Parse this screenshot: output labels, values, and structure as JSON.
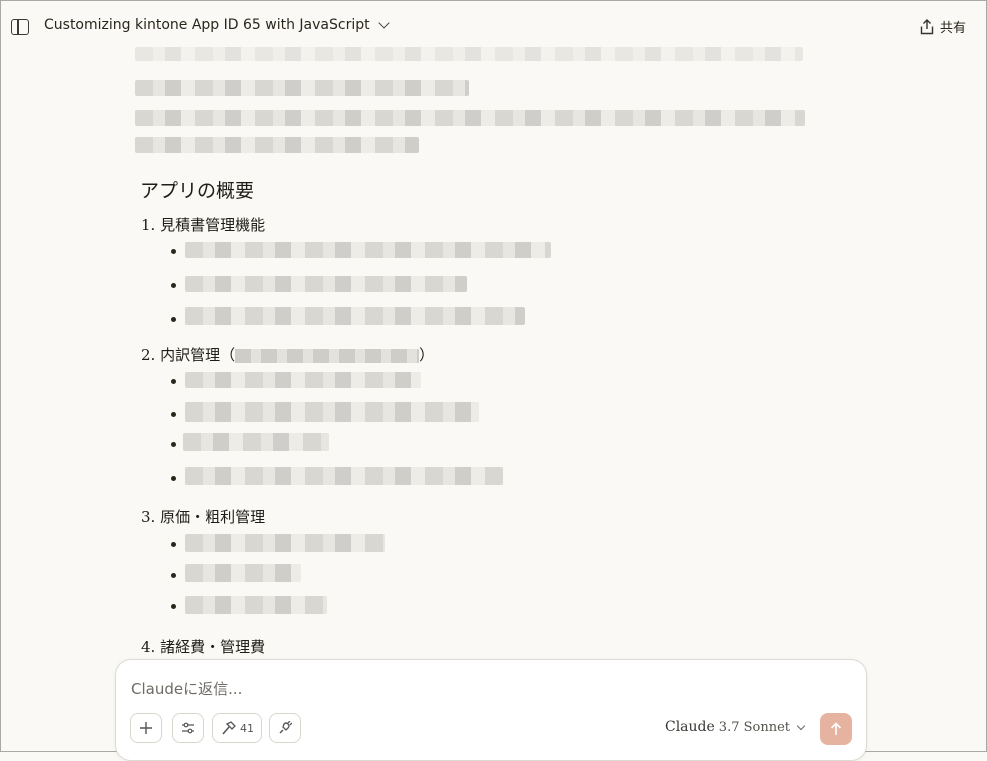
{
  "header": {
    "title": "Customizing kintone App ID 65 with JavaScript",
    "share_label": "共有"
  },
  "content": {
    "section_heading": "アプリの概要",
    "items": [
      {
        "label": "1. 見積書管理機能"
      },
      {
        "label": "2. 内訳管理（",
        "suffix": "）"
      },
      {
        "label": "3. 原価・粗利管理"
      },
      {
        "label": "4. 諸経費・管理費"
      }
    ]
  },
  "composer": {
    "placeholder": "Claudeに返信...",
    "tools_count": "41",
    "model_name": "Claude",
    "model_version": "3.7 Sonnet"
  }
}
